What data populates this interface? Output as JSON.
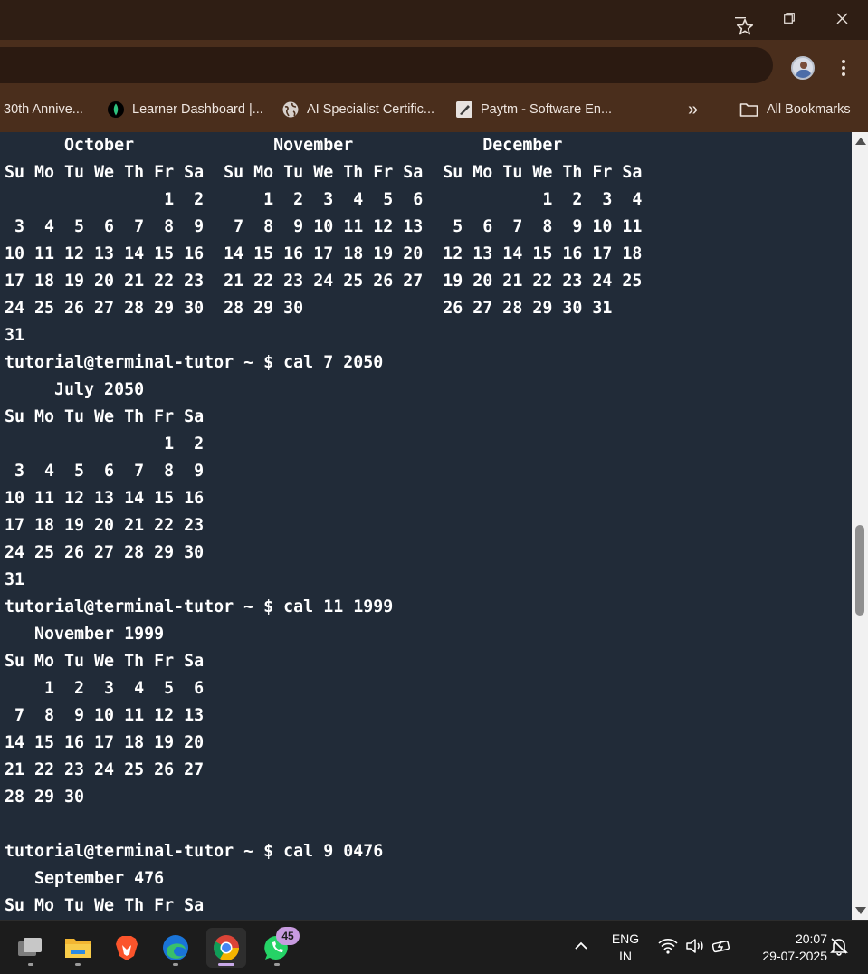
{
  "window": {
    "minimize_glyph": "—",
    "icons": [
      "minimize-icon",
      "restore-icon",
      "close-icon"
    ]
  },
  "bookmarks": [
    {
      "label": "30th Annive...",
      "icon": "none"
    },
    {
      "label": "Learner Dashboard |...",
      "icon": "leaf-icon"
    },
    {
      "label": "AI Specialist Certific...",
      "icon": "globe-icon"
    },
    {
      "label": "Paytm - Software En...",
      "icon": "pen-icon"
    }
  ],
  "bookmarks_overflow": "»",
  "all_bookmarks_label": "All Bookmarks",
  "terminal": {
    "text": "      October              November             December\nSu Mo Tu We Th Fr Sa  Su Mo Tu We Th Fr Sa  Su Mo Tu We Th Fr Sa\n                1  2      1  2  3  4  5  6            1  2  3  4\n 3  4  5  6  7  8  9   7  8  9 10 11 12 13   5  6  7  8  9 10 11\n10 11 12 13 14 15 16  14 15 16 17 18 19 20  12 13 14 15 16 17 18\n17 18 19 20 21 22 23  21 22 23 24 25 26 27  19 20 21 22 23 24 25\n24 25 26 27 28 29 30  28 29 30              26 27 28 29 30 31\n31\ntutorial@terminal-tutor ~ $ cal 7 2050\n     July 2050\nSu Mo Tu We Th Fr Sa\n                1  2\n 3  4  5  6  7  8  9\n10 11 12 13 14 15 16\n17 18 19 20 21 22 23\n24 25 26 27 28 29 30\n31\ntutorial@terminal-tutor ~ $ cal 11 1999\n   November 1999\nSu Mo Tu We Th Fr Sa\n    1  2  3  4  5  6\n 7  8  9 10 11 12 13\n14 15 16 17 18 19 20\n21 22 23 24 25 26 27\n28 29 30\n\ntutorial@terminal-tutor ~ $ cal 9 0476\n   September 476\nSu Mo Tu We Th Fr Sa"
  },
  "taskbar": {
    "apps": [
      "task-view",
      "file-explorer",
      "brave",
      "edge",
      "chrome",
      "whatsapp"
    ],
    "whatsapp_badge": "45",
    "language_line1": "ENG",
    "language_line2": "IN",
    "time": "20:07",
    "date": "29-07-2025"
  },
  "colors": {
    "terminal_bg": "#212b38",
    "titlebar": "#2f1e14",
    "toolbar": "#4a2e1c",
    "taskbar": "#1c1c1c"
  }
}
